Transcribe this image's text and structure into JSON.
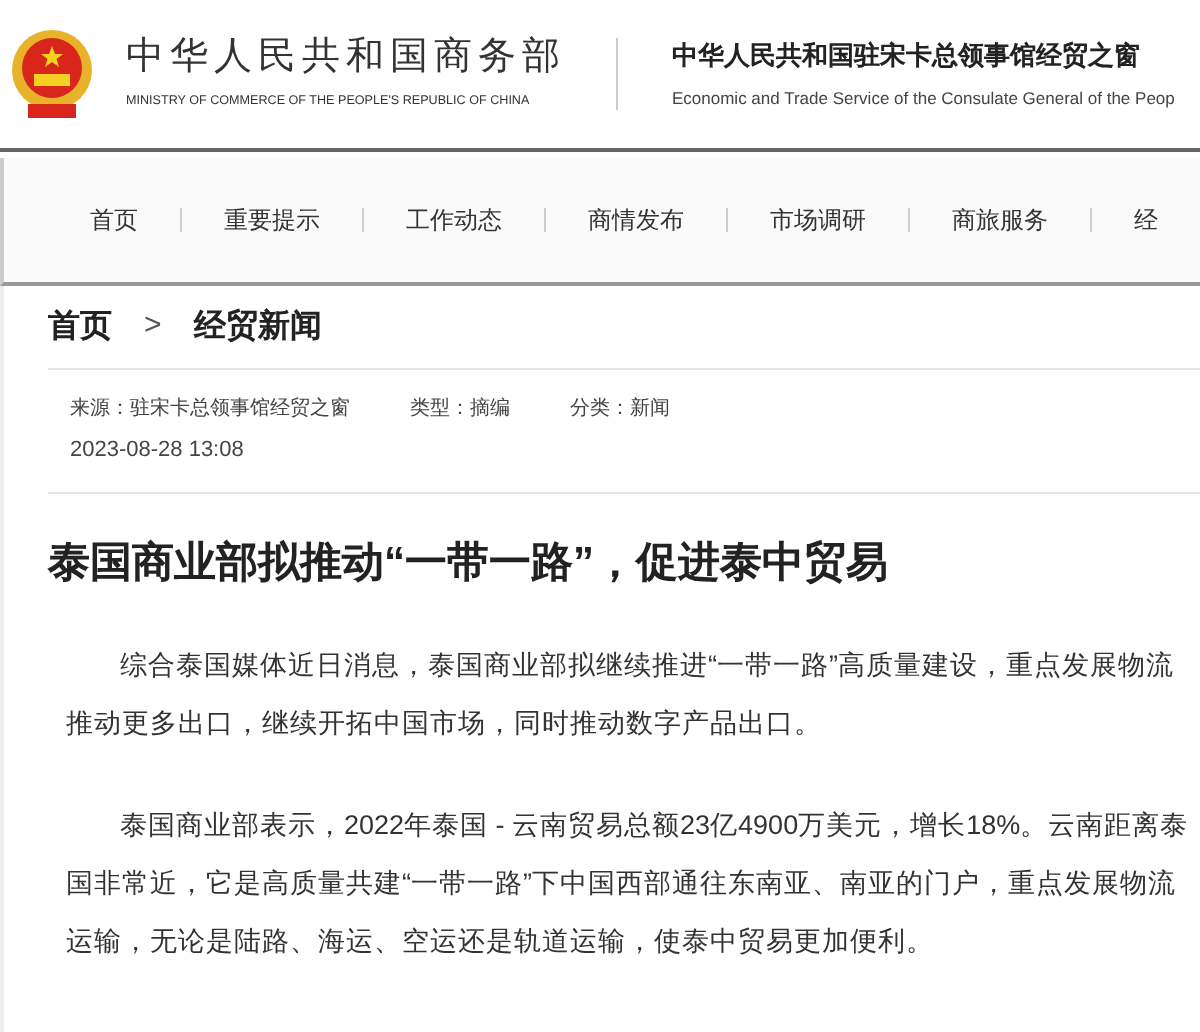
{
  "header": {
    "ministry_title": "中华人民共和国商务部",
    "ministry_subtitle": "MINISTRY OF COMMERCE OF THE PEOPLE'S REPUBLIC OF CHINA",
    "site_title": "中华人民共和国驻宋卡总领事馆经贸之窗",
    "site_subtitle": "Economic and Trade Service of the Consulate General of the Peop"
  },
  "nav": [
    {
      "label": "首页"
    },
    {
      "label": "重要提示"
    },
    {
      "label": "工作动态"
    },
    {
      "label": "商情发布"
    },
    {
      "label": "市场调研"
    },
    {
      "label": "商旅服务"
    },
    {
      "label": "经"
    }
  ],
  "breadcrumb": [
    {
      "label": "首页"
    },
    {
      "separator": ">",
      "label": "经贸新闻"
    }
  ],
  "meta": {
    "fields": [
      "来源：驻宋卡总领事馆经贸之窗",
      "类型：摘编",
      "分类：新闻"
    ],
    "date": "2023-08-28 13:08"
  },
  "article": {
    "title": "泰国商业部拟推动“一带一路”，促进泰中贸易",
    "paragraphs": [
      "综合泰国媒体近日消息，泰国商业部拟继续推进“一带一路”高质量建设，重点发展物流推动更多出口，继续开拓中国市场，同时推动数字产品出口。",
      "泰国商业部表示，2022年泰国 - 云南贸易总额23亿4900万美元，增长18%。云南距离泰国非常近，它是高质量共建“一带一路”下中国西部通往东南亚、南亚的门户，重点发展物流运输，无论是陆路、海运、空运还是轨道运输，使泰中贸易更加便利。"
    ]
  }
}
